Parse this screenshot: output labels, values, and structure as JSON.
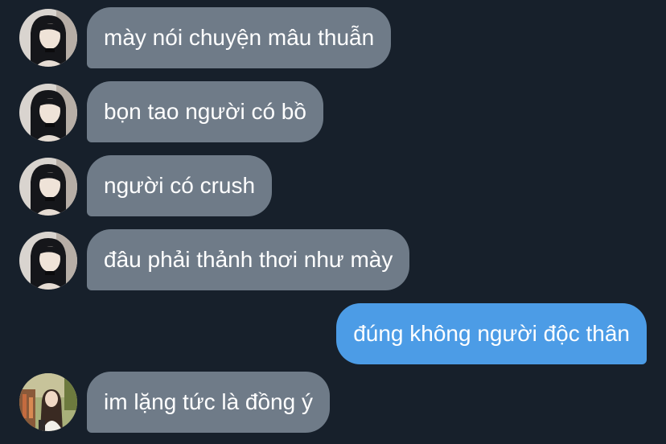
{
  "conversation": {
    "messages": [
      {
        "sender": "other",
        "avatar": "girl-dark-hair-avatar",
        "text": "mày nói chuyện mâu thuẫn"
      },
      {
        "sender": "other",
        "avatar": "girl-dark-hair-avatar",
        "text": "bọn tao người có bồ"
      },
      {
        "sender": "other",
        "avatar": "girl-dark-hair-avatar",
        "text": "người có crush"
      },
      {
        "sender": "other",
        "avatar": "girl-dark-hair-avatar",
        "text": "đâu phải thảnh thơi như mày"
      },
      {
        "sender": "me",
        "text": "đúng không người độc thân"
      },
      {
        "sender": "other2",
        "avatar": "girl-outdoor-avatar",
        "text": "im lặng tức là đồng ý"
      }
    ]
  },
  "colors": {
    "background": "#17202b",
    "incoming_bubble": "#6f7b88",
    "outgoing_bubble": "#4c9ce6",
    "text": "#ffffff"
  }
}
